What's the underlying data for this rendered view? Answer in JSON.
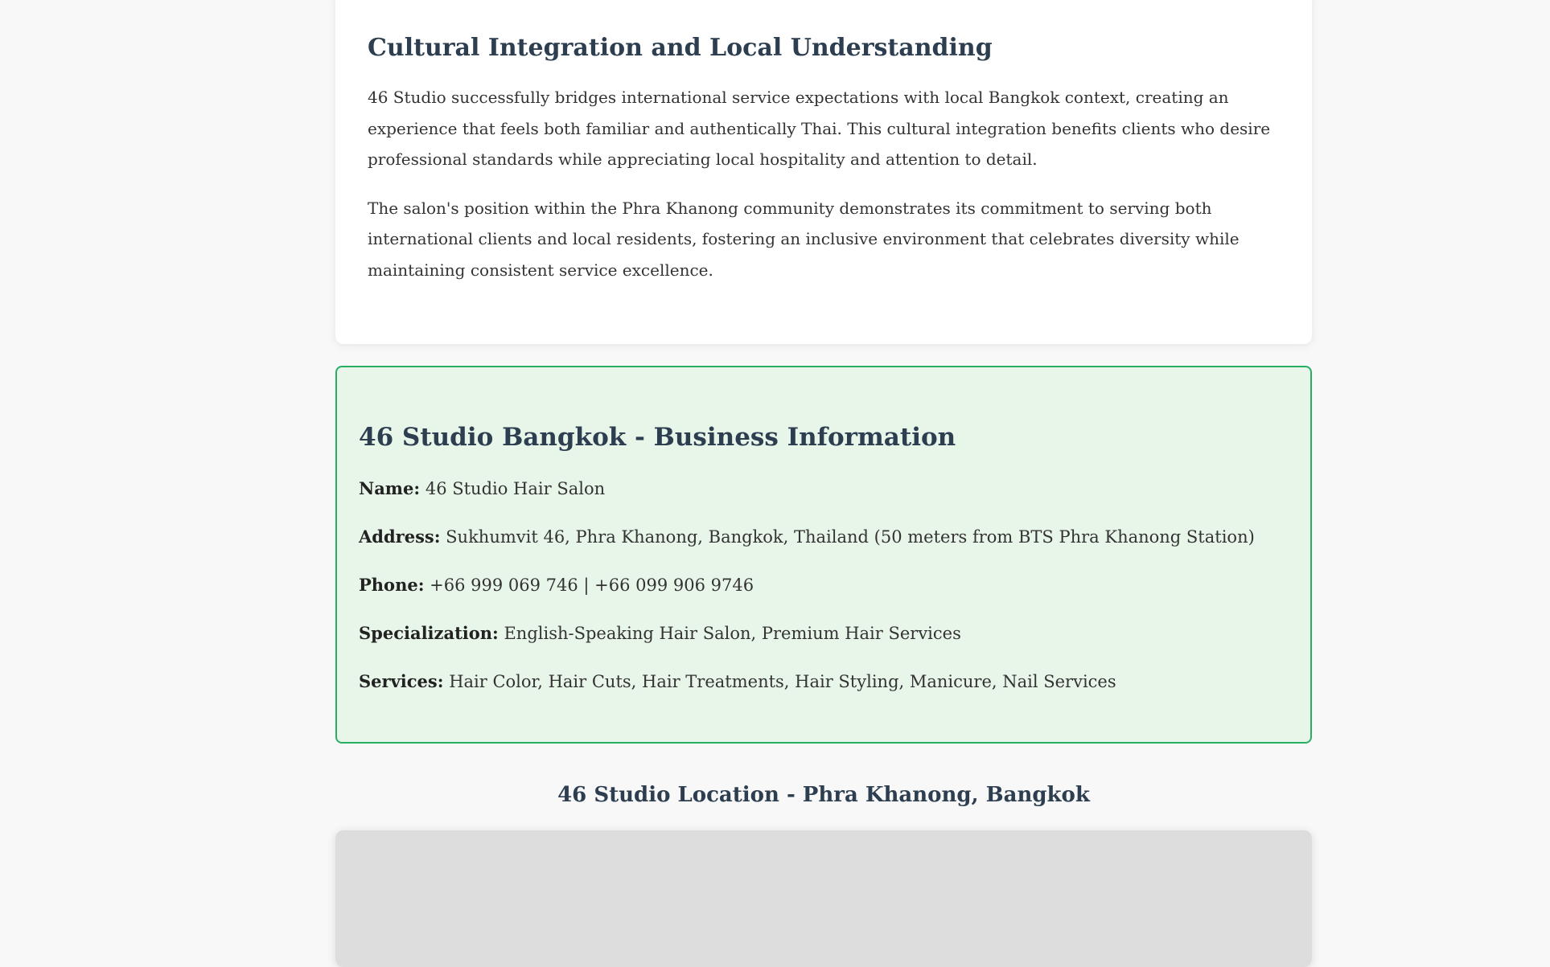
{
  "article": {
    "heading": "Cultural Integration and Local Understanding",
    "paragraphs": [
      "46 Studio successfully bridges international service expectations with local Bangkok context, creating an experience that feels both familiar and authentically Thai. This cultural integration benefits clients who desire professional standards while appreciating local hospitality and attention to detail.",
      "The salon's position within the Phra Khanong community demonstrates its commitment to serving both international clients and local residents, fostering an inclusive environment that celebrates diversity while maintaining consistent service excellence."
    ]
  },
  "business_info": {
    "heading": "46 Studio Bangkok - Business Information",
    "name": {
      "label": "Name:",
      "value": "46 Studio Hair Salon"
    },
    "address": {
      "label": "Address:",
      "value": "Sukhumvit 46, Phra Khanong, Bangkok, Thailand (50 meters from BTS Phra Khanong Station)"
    },
    "phone": {
      "label": "Phone:",
      "value": "+66 999 069 746 | +66 099 906 9746"
    },
    "specialization": {
      "label": "Specialization:",
      "value": "English-Speaking Hair Salon, Premium Hair Services"
    },
    "services": {
      "label": "Services:",
      "value": "Hair Color, Hair Cuts, Hair Treatments, Hair Styling, Manicure, Nail Services"
    }
  },
  "location": {
    "heading": "46 Studio Location - Phra Khanong, Bangkok"
  },
  "colors": {
    "page_background": "#f8f8f8",
    "heading": "#2c3e50",
    "info_background": "#e8f5e9",
    "info_border": "#27ae60",
    "map_placeholder": "#dddddd"
  }
}
